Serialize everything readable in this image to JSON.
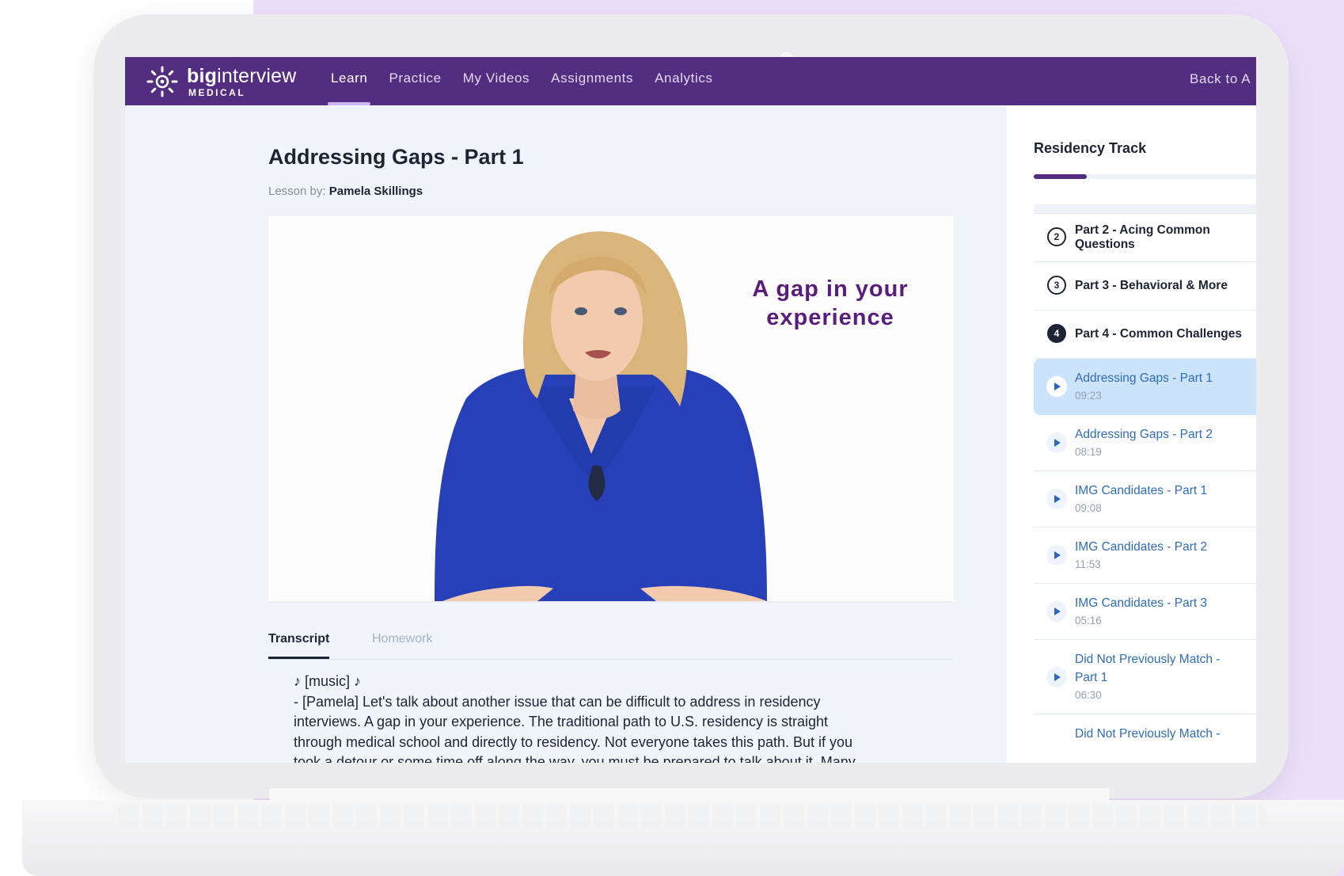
{
  "app": {
    "brand_main_bold": "big",
    "brand_main_rest": "interview",
    "brand_sub": "MEDICAL"
  },
  "nav": {
    "items": [
      {
        "label": "Learn",
        "active": true
      },
      {
        "label": "Practice",
        "active": false
      },
      {
        "label": "My Videos",
        "active": false
      },
      {
        "label": "Assignments",
        "active": false
      },
      {
        "label": "Analytics",
        "active": false
      }
    ],
    "back_label": "Back to A"
  },
  "lesson": {
    "title": "Addressing Gaps - Part 1",
    "by_prefix": "Lesson by:",
    "author": "Pamela Skillings",
    "video_caption": "A gap in your experience"
  },
  "tabs": {
    "transcript": "Transcript",
    "homework": "Homework"
  },
  "transcript": {
    "lines": [
      "♪ [music] ♪",
      "- [Pamela] Let's talk about another issue that can be difficult to address in residency",
      "interviews. A gap in your experience. The traditional path to U.S. residency is straight",
      "through medical school and directly to residency. Not everyone takes this path. But if you",
      "took a detour or some time off along the way, you must be prepared to talk about it. Many"
    ]
  },
  "sidebar": {
    "title": "Residency Track",
    "progress_fraction": 0.23,
    "parts": [
      {
        "num": "2",
        "label_line1": "Part 2 - Acing Common",
        "label_line2": "Questions",
        "current": false
      },
      {
        "num": "3",
        "label_line1": "Part 3 - Behavioral & More",
        "label_line2": "",
        "current": false
      },
      {
        "num": "4",
        "label_line1": "Part 4 - Common Challenges",
        "label_line2": "",
        "current": true
      }
    ],
    "lessons": [
      {
        "title": "Addressing Gaps - Part 1",
        "title2": "",
        "duration": "09:23",
        "active": true
      },
      {
        "title": "Addressing Gaps - Part 2",
        "title2": "",
        "duration": "08:19",
        "active": false
      },
      {
        "title": "IMG Candidates - Part 1",
        "title2": "",
        "duration": "09:08",
        "active": false
      },
      {
        "title": "IMG Candidates - Part 2",
        "title2": "",
        "duration": "11:53",
        "active": false
      },
      {
        "title": "IMG Candidates - Part 3",
        "title2": "",
        "duration": "05:16",
        "active": false
      },
      {
        "title": "Did Not Previously Match -",
        "title2": "Part 1",
        "duration": "06:30",
        "active": false
      },
      {
        "title": "Did Not Previously Match -",
        "title2": "",
        "duration": "",
        "active": false
      }
    ],
    "play_icon": "play-icon"
  },
  "colors": {
    "topbar": "#522d80",
    "caption": "#5a1d7c",
    "sweater": "#2740b8",
    "active_lesson_bg": "#cce3fc",
    "link_blue": "#2f6cb9"
  }
}
